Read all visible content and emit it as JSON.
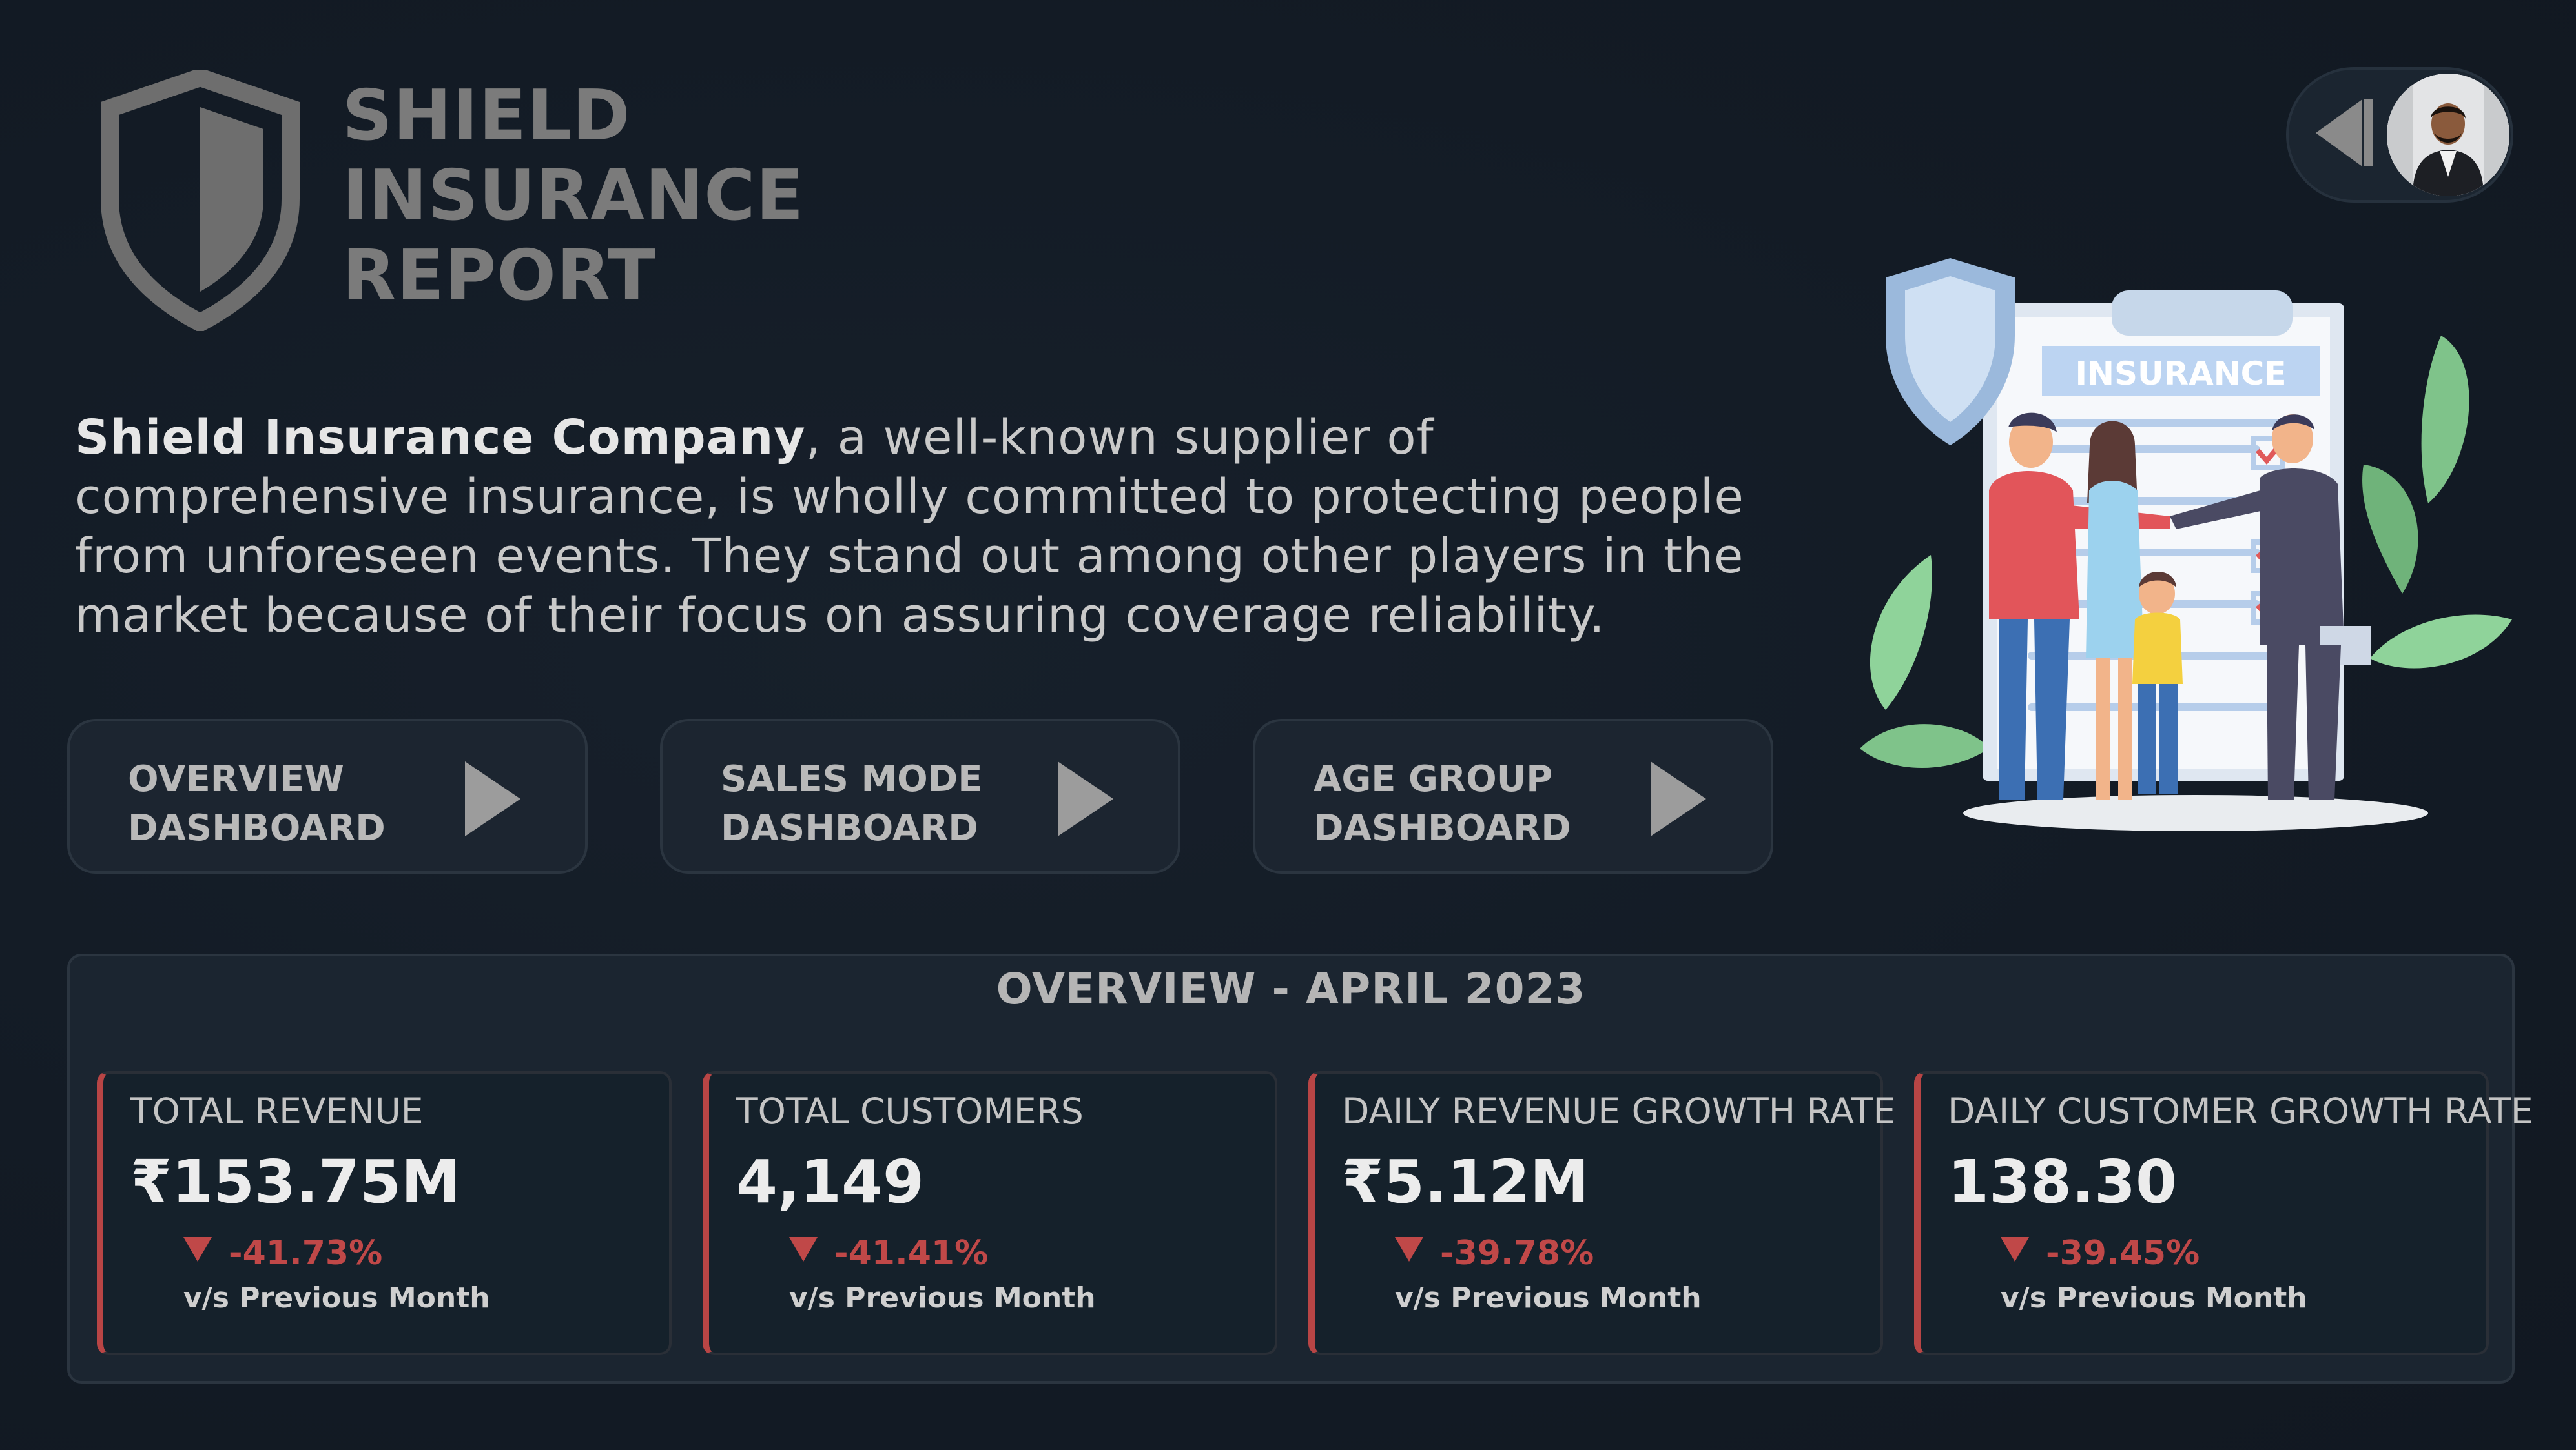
{
  "header": {
    "title_lines": [
      "SHIELD",
      "INSURANCE",
      "REPORT"
    ]
  },
  "description": {
    "company": "Shield Insurance Company",
    "text": ", a well-known supplier of comprehensive insurance, is wholly committed to protecting people from unforeseen events. They stand out among other players in the market because of their focus on assuring coverage reliability."
  },
  "nav": [
    {
      "label": "OVERVIEW\nDASHBOARD",
      "icon": "play-icon"
    },
    {
      "label": "SALES MODE\nDASHBOARD",
      "icon": "play-icon"
    },
    {
      "label": "AGE GROUP\nDASHBOARD",
      "icon": "play-icon"
    }
  ],
  "illustration": {
    "board_text": "INSURANCE"
  },
  "overview": {
    "title": "OVERVIEW - APRIL 2023",
    "kpis": [
      {
        "title": "TOTAL REVENUE",
        "value": "₹153.75M",
        "change": "-41.73%",
        "sub": "v/s Previous Month"
      },
      {
        "title": "TOTAL CUSTOMERS",
        "value": "4,149",
        "change": "-41.41%",
        "sub": "v/s Previous Month"
      },
      {
        "title": "DAILY REVENUE GROWTH RATE",
        "value": "₹5.12M",
        "change": "-39.78%",
        "sub": "v/s Previous Month"
      },
      {
        "title": "DAILY CUSTOMER GROWTH RATE",
        "value": "138.30",
        "change": "-39.45%",
        "sub": "v/s Previous Month"
      }
    ]
  },
  "colors": {
    "background": "#131b25",
    "panel": "#1b2530",
    "negative": "#c04848",
    "title_gray": "#7b7b7b"
  },
  "icons": [
    "shield-logo-icon",
    "back-arrow-icon",
    "play-icon",
    "down-triangle-icon"
  ]
}
